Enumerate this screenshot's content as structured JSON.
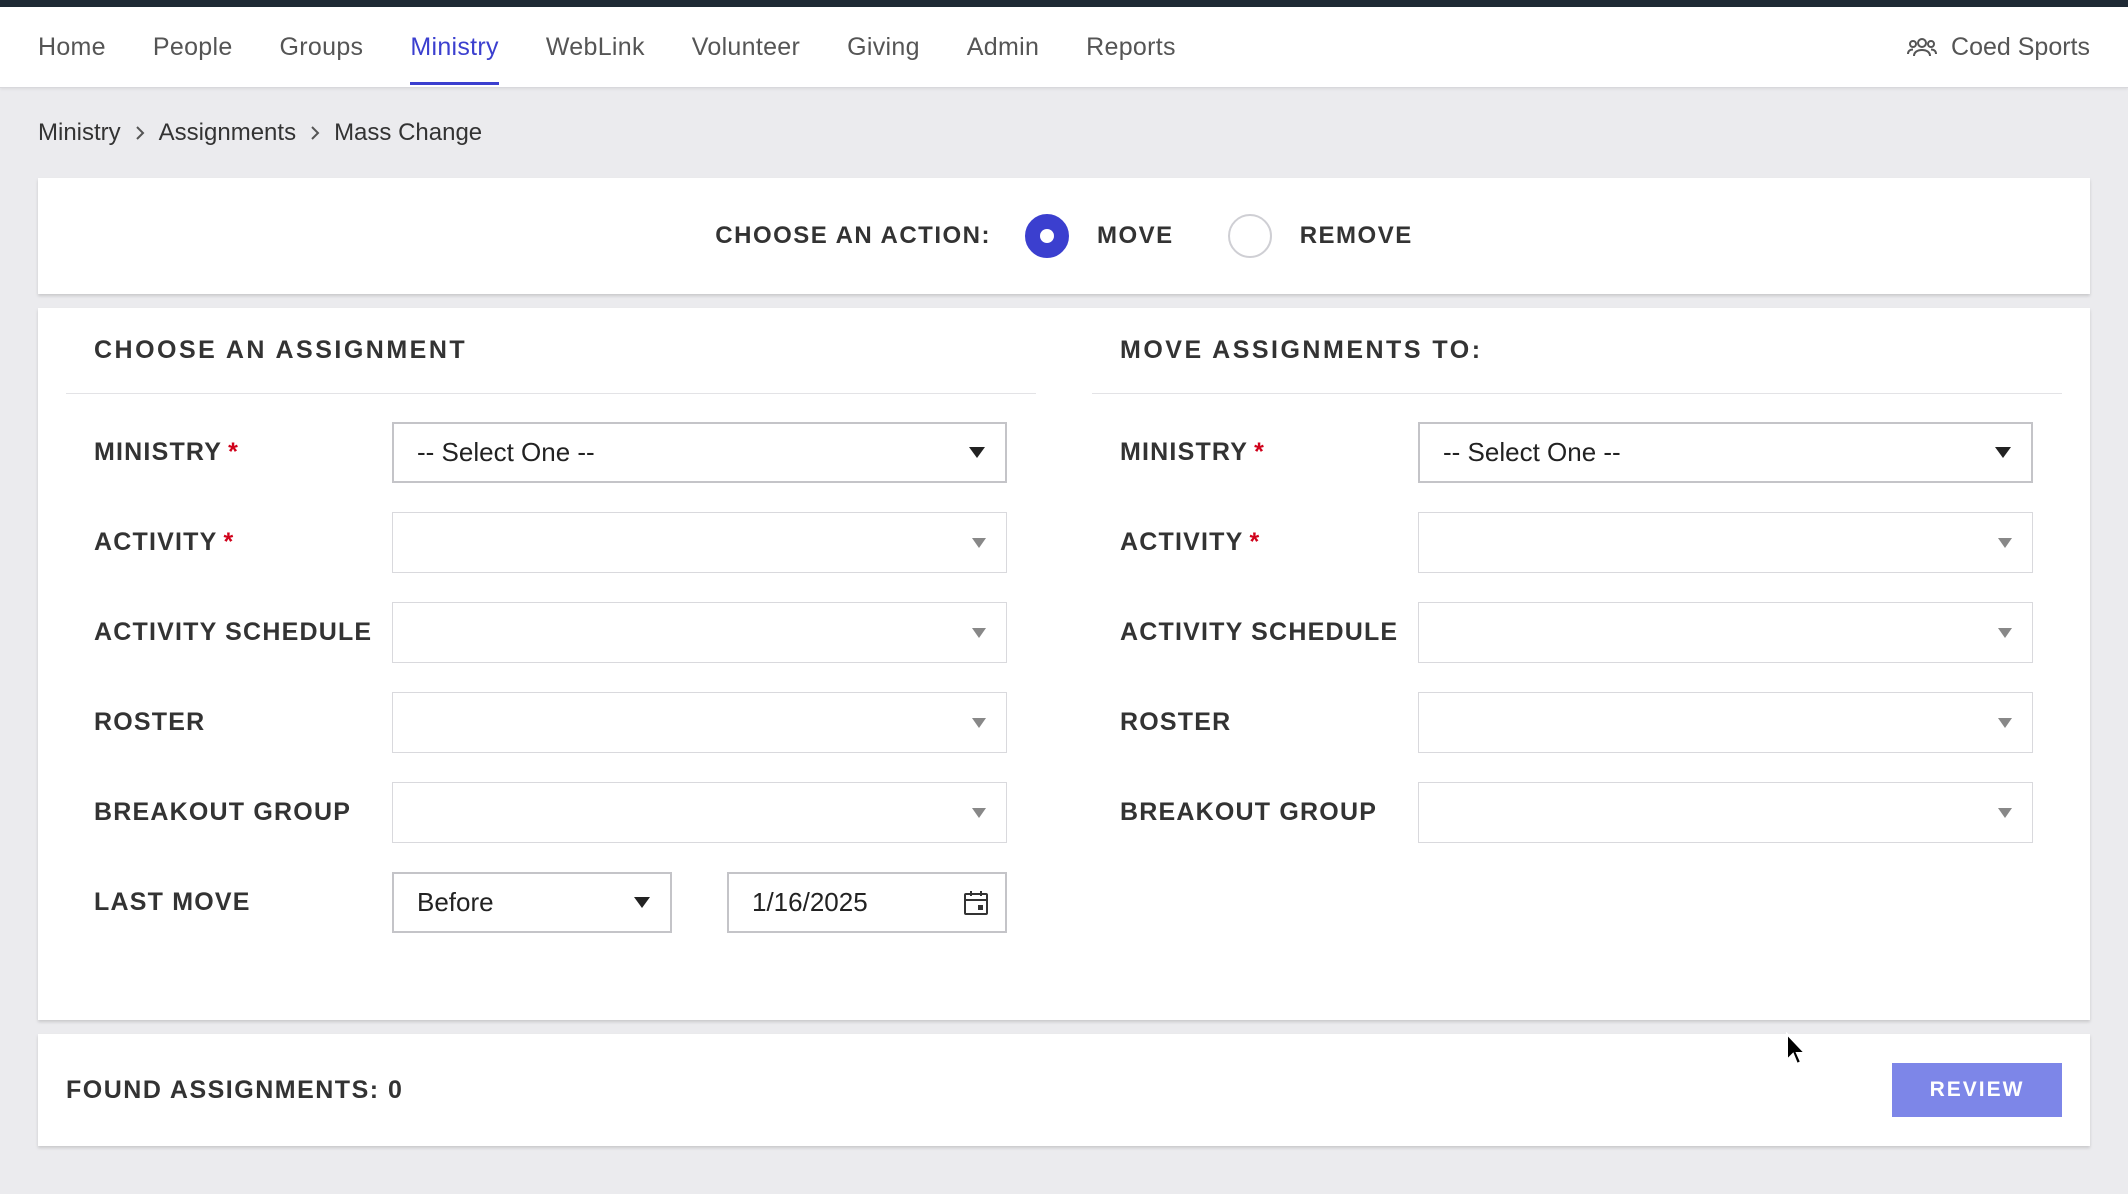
{
  "nav": {
    "items": [
      {
        "label": "Home",
        "active": false
      },
      {
        "label": "People",
        "active": false
      },
      {
        "label": "Groups",
        "active": false
      },
      {
        "label": "Ministry",
        "active": true
      },
      {
        "label": "WebLink",
        "active": false
      },
      {
        "label": "Volunteer",
        "active": false
      },
      {
        "label": "Giving",
        "active": false
      },
      {
        "label": "Admin",
        "active": false
      },
      {
        "label": "Reports",
        "active": false
      }
    ],
    "org_name": "Coed Sports",
    "org_icon": "people-group-icon"
  },
  "breadcrumb": [
    "Ministry",
    "Assignments",
    "Mass Change"
  ],
  "action": {
    "label": "CHOOSE AN ACTION:",
    "options": [
      {
        "label": "MOVE",
        "checked": true
      },
      {
        "label": "REMOVE",
        "checked": false
      }
    ]
  },
  "source": {
    "title": "CHOOSE AN ASSIGNMENT",
    "fields": {
      "ministry": {
        "label": "MINISTRY",
        "value": "-- Select One --"
      },
      "activity": {
        "label": "ACTIVITY",
        "value": ""
      },
      "activity_schedule": {
        "label": "ACTIVITY SCHEDULE",
        "value": ""
      },
      "roster": {
        "label": "ROSTER",
        "value": ""
      },
      "breakout_group": {
        "label": "BREAKOUT GROUP",
        "value": ""
      },
      "last_move": {
        "label": "LAST MOVE",
        "operator": "Before",
        "date": "1/16/2025"
      }
    }
  },
  "target": {
    "title": "MOVE ASSIGNMENTS TO:",
    "fields": {
      "ministry": {
        "label": "MINISTRY",
        "value": "-- Select One --"
      },
      "activity": {
        "label": "ACTIVITY",
        "value": ""
      },
      "activity_schedule": {
        "label": "ACTIVITY SCHEDULE",
        "value": ""
      },
      "roster": {
        "label": "ROSTER",
        "value": ""
      },
      "breakout_group": {
        "label": "BREAKOUT GROUP",
        "value": ""
      }
    }
  },
  "required_marker": "*",
  "found": {
    "text": "FOUND ASSIGNMENTS: 0"
  },
  "review_button": {
    "label": "REVIEW"
  },
  "colors": {
    "accent": "#3b3fcf",
    "button": "#7d86e8",
    "required": "#d0021b"
  }
}
